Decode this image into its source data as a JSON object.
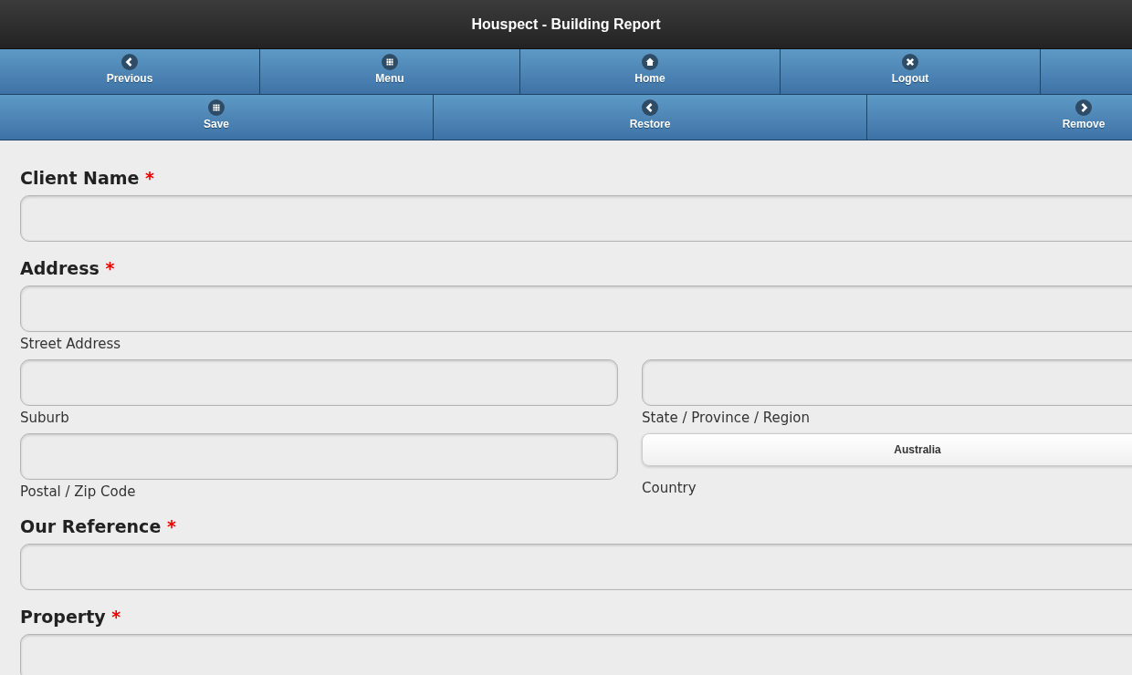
{
  "window": {
    "title": "Houspect - Building Report"
  },
  "nav_rows": [
    [
      {
        "label": "Previous",
        "kind": "back"
      },
      {
        "label": "Menu",
        "kind": "grid"
      },
      {
        "label": "Home",
        "kind": "home"
      },
      {
        "label": "Logout",
        "kind": "close"
      },
      {
        "kind": "blank"
      }
    ],
    [
      {
        "label": "Save",
        "kind": "grid"
      },
      {
        "label": "Restore",
        "kind": "back"
      },
      {
        "label": "Remove",
        "kind": "forward"
      }
    ]
  ],
  "fields": [
    {
      "kind": "text",
      "label": "Client Name",
      "marker": "*"
    },
    {
      "kind": "group",
      "label": "Address",
      "marker": "*",
      "rows": [
        [
          {
            "kind": "input",
            "caption": "Street Address"
          }
        ],
        [
          {
            "kind": "input",
            "caption": "Suburb"
          },
          {
            "kind": "input",
            "caption": "State / Province / Region"
          }
        ],
        [
          {
            "kind": "input",
            "caption": "Postal / Zip Code"
          },
          {
            "kind": "select",
            "caption": "Country",
            "value": "Australia"
          }
        ]
      ]
    },
    {
      "kind": "text",
      "label": "Our Reference",
      "marker": "*"
    },
    {
      "kind": "text",
      "label": "Property",
      "marker": "*"
    }
  ]
}
